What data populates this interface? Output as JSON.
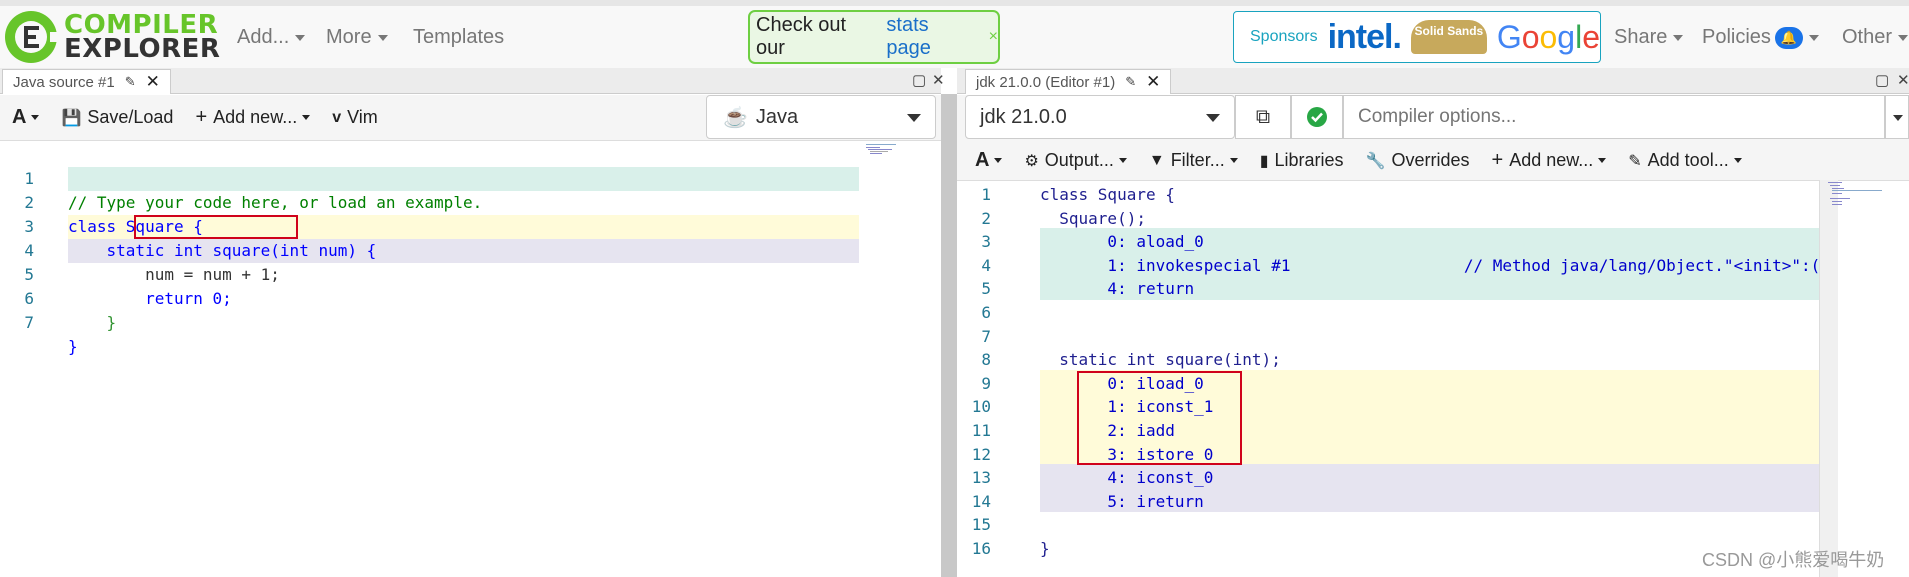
{
  "app": {
    "logo_line1": "COMPILER",
    "logo_line2": "EXPLORER",
    "nav": {
      "add": "Add...",
      "more": "More",
      "templates": "Templates",
      "share": "Share",
      "policies": "Policies",
      "other": "Other"
    },
    "notice": {
      "text": "Check out our",
      "link": "stats page",
      "close": "×"
    },
    "sponsors": {
      "label": "Sponsors",
      "intel": "intel.",
      "solid": "Solid Sands",
      "google": "Google"
    },
    "policies_badge": "🔔",
    "colors": {
      "green": "#67c52a",
      "blue": "#1a6fc9",
      "teal": "#19a3bf",
      "red": "#d0021b"
    }
  },
  "source_pane": {
    "tab_title": "Java source #1",
    "toolbar": {
      "font": "A",
      "save_load": "Save/Load",
      "add_new": "Add new...",
      "vim": "Vim"
    },
    "language": "Java",
    "lines": [
      {
        "n": "1",
        "text": "// Type your code here, or load an example."
      },
      {
        "n": "2",
        "text": "class Square {"
      },
      {
        "n": "3",
        "text": "    static int square(int num) {"
      },
      {
        "n": "4",
        "text": "        num = num + 1;"
      },
      {
        "n": "5",
        "text": "        return 0;"
      },
      {
        "n": "6",
        "text": "    }"
      },
      {
        "n": "7",
        "text": "}"
      }
    ]
  },
  "compiler_pane": {
    "tab_title": "jdk 21.0.0 (Editor #1)",
    "compiler": "jdk 21.0.0",
    "options_placeholder": "Compiler options...",
    "toolbar": {
      "font": "A",
      "output": "Output...",
      "filter": "Filter...",
      "libraries": "Libraries",
      "overrides": "Overrides",
      "add_new": "Add new...",
      "add_tool": "Add tool..."
    },
    "lines": [
      {
        "n": "1",
        "text": "class Square {"
      },
      {
        "n": "2",
        "text": "  Square();"
      },
      {
        "n": "3",
        "text": "       0: aload_0"
      },
      {
        "n": "4",
        "text": "       1: invokespecial #1                  // Method java/lang/Object.\"<init>\":("
      },
      {
        "n": "5",
        "text": "       4: return"
      },
      {
        "n": "6",
        "text": ""
      },
      {
        "n": "7",
        "text": ""
      },
      {
        "n": "8",
        "text": "  static int square(int);"
      },
      {
        "n": "9",
        "text": "       0: iload_0"
      },
      {
        "n": "10",
        "text": "       1: iconst_1"
      },
      {
        "n": "11",
        "text": "       2: iadd"
      },
      {
        "n": "12",
        "text": "       3: istore_0"
      },
      {
        "n": "13",
        "text": "       4: iconst_0"
      },
      {
        "n": "14",
        "text": "       5: ireturn"
      },
      {
        "n": "15",
        "text": ""
      },
      {
        "n": "16",
        "text": "}"
      }
    ]
  },
  "watermark": "CSDN @小熊爱喝牛奶"
}
